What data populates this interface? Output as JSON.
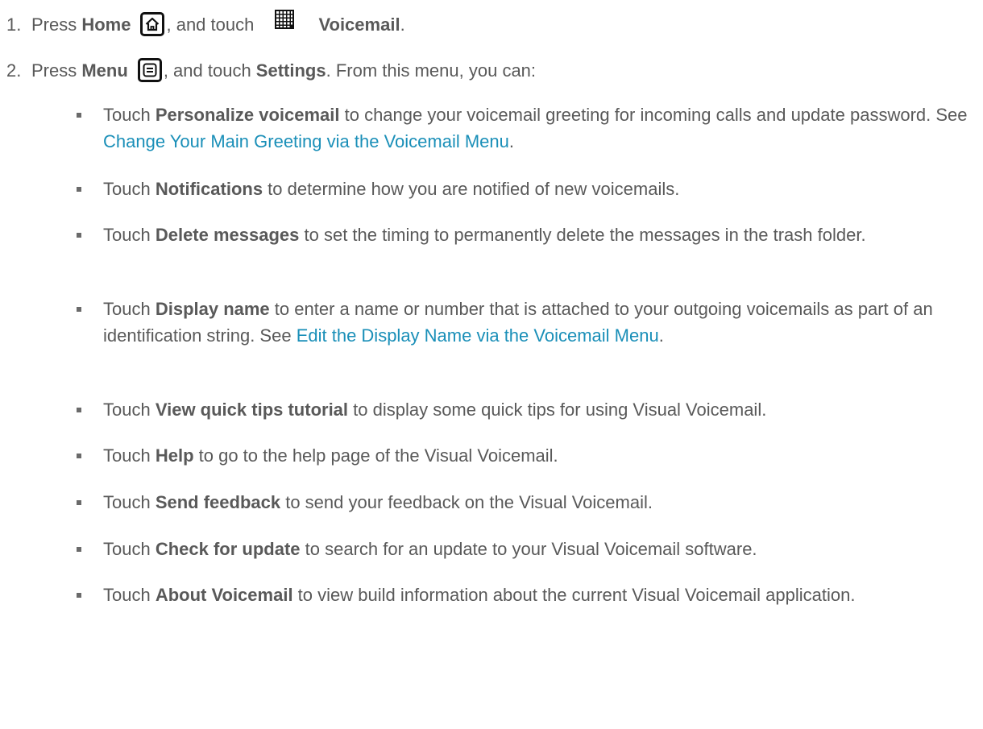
{
  "steps": [
    {
      "num": "1.",
      "t1": "Press ",
      "b1": "Home",
      "home_icon": "home-icon",
      "t2": ", and touch ",
      "apps_icon": "apps-grid-icon",
      "b2": "Voicemail",
      "t3": "."
    },
    {
      "num": "2.",
      "t1": "Press ",
      "b1": "Menu",
      "menu_icon": "menu-icon",
      "t2": ", and touch ",
      "b2": "Settings",
      "t3": ". From this menu, you can:"
    }
  ],
  "options": [
    {
      "pre": "Touch ",
      "bold": "Personalize voicemail",
      "post": " to change your voicemail greeting for incoming calls and update password. See ",
      "link": "Change Your Main Greeting via the Voicemail Menu",
      "end": "."
    },
    {
      "pre": "Touch ",
      "bold": "Notifications",
      "post": " to determine how you are notified of new voicemails."
    },
    {
      "pre": "Touch ",
      "bold": "Delete messages",
      "post": " to set the timing to permanently delete the messages in the trash folder."
    },
    {
      "pre": "Touch ",
      "bold": "Display name",
      "post": " to enter a name or number that is attached to your outgoing voicemails as part of an identification string. See ",
      "link": "Edit the Display Name via the Voicemail Menu",
      "end": "."
    },
    {
      "pre": "Touch ",
      "bold": "View quick tips tutorial",
      "post": " to display some quick tips for using Visual Voicemail."
    },
    {
      "pre": "Touch ",
      "bold": "Help",
      "post": " to go to the help page of the Visual Voicemail."
    },
    {
      "pre": "Touch ",
      "bold": "Send feedback",
      "post": " to send your feedback on the Visual Voicemail."
    },
    {
      "pre": "Touch ",
      "bold": "Check for update",
      "post": " to search for an update to your Visual Voicemail software."
    },
    {
      "pre": "Touch ",
      "bold": "About Voicemail",
      "post": " to view build information about the current Visual Voicemail application."
    }
  ],
  "colors": {
    "text": "#595959",
    "link": "#1a8fb8",
    "bullet": "#6a6a6a"
  }
}
